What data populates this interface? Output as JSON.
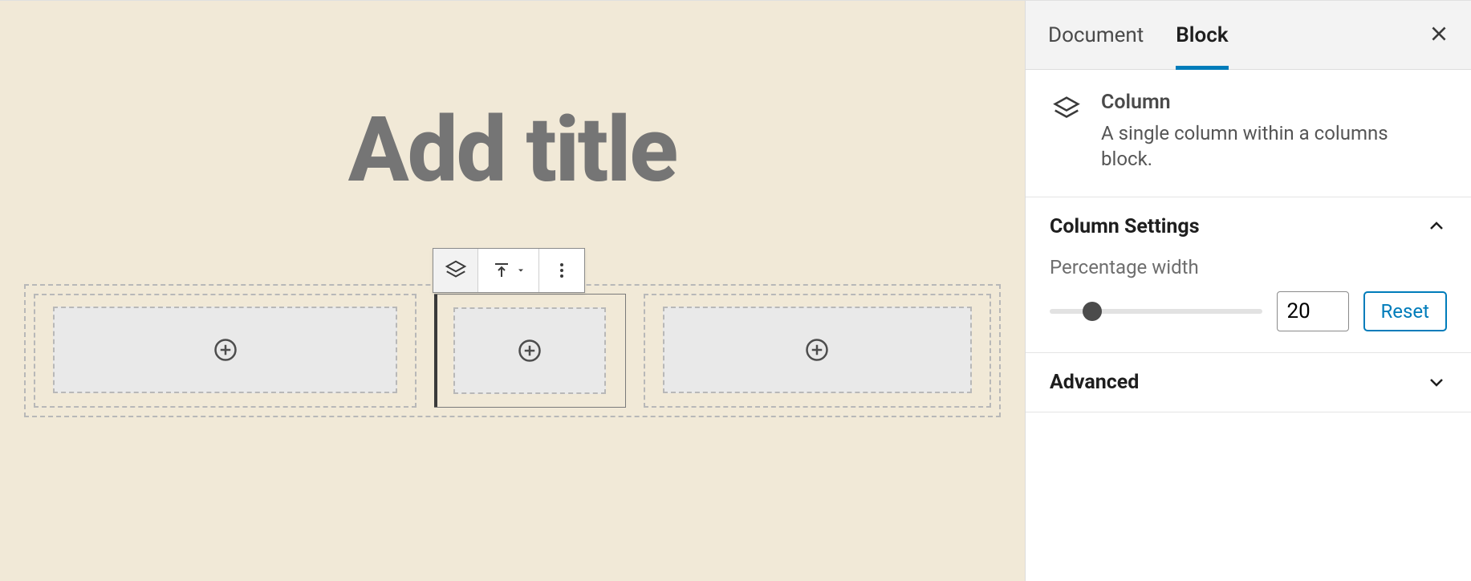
{
  "editor": {
    "title_placeholder": "Add title"
  },
  "sidebar": {
    "tabs": {
      "document_label": "Document",
      "block_label": "Block",
      "active": "block"
    },
    "block_card": {
      "title": "Column",
      "description": "A single column within a columns block."
    },
    "panels": {
      "column_settings": {
        "title": "Column Settings",
        "expanded": true,
        "percentage_width_label": "Percentage width",
        "percentage_width_value": "20",
        "reset_label": "Reset"
      },
      "advanced": {
        "title": "Advanced",
        "expanded": false
      }
    }
  },
  "icons": {
    "column": "column-icon",
    "align_top": "align-top-icon",
    "more": "more-vertical-icon",
    "plus": "plus-circle-icon",
    "close": "close-icon",
    "chevron_up": "chevron-up-icon",
    "chevron_down": "chevron-down-icon",
    "caret_down": "caret-down-icon"
  }
}
